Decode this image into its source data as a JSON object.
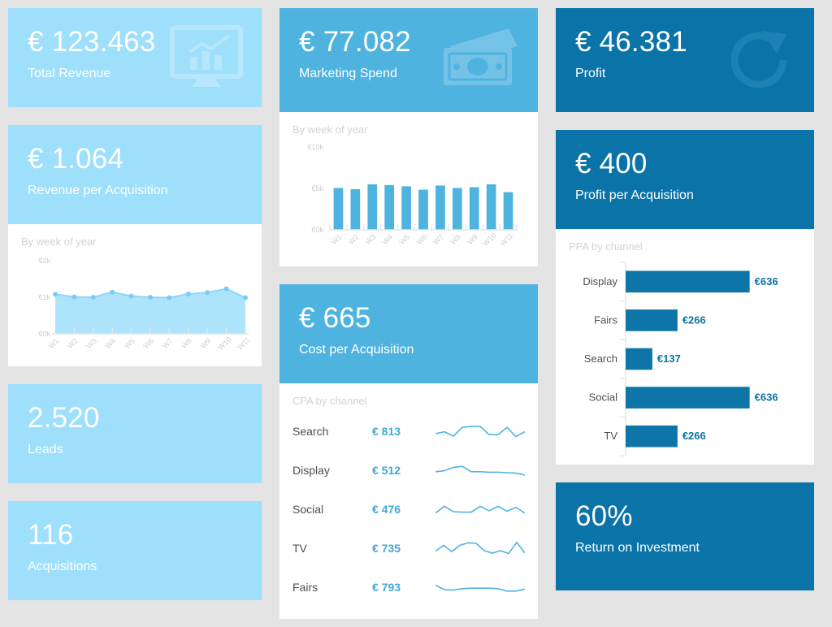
{
  "theme": {
    "light_blue": "#9edffb",
    "mid_blue": "#4fb3e0",
    "dark_blue": "#0a74a8",
    "page_bg": "#e4e4e4",
    "panel_bg": "#ffffff",
    "muted_text": "#cfd2d4"
  },
  "kpis": {
    "total_revenue": {
      "value": "€ 123.463",
      "label": "Total Revenue",
      "icon": "monitor-chart-icon"
    },
    "revenue_per_acq": {
      "value": "€ 1.064",
      "label": "Revenue per Acquisition",
      "icon": "none"
    },
    "leads": {
      "value": "2.520",
      "label": "Leads",
      "icon": "none"
    },
    "acquisitions": {
      "value": "116",
      "label": "Acquisitions",
      "icon": "none"
    },
    "marketing_spend": {
      "value": "€ 77.082",
      "label": "Marketing Spend",
      "icon": "banknotes-icon"
    },
    "cost_per_acq": {
      "value": "€ 665",
      "label": "Cost per Acquisition",
      "icon": "none"
    },
    "profit": {
      "value": "€ 46.381",
      "label": "Profit",
      "icon": "refresh-circle-icon"
    },
    "profit_per_acq": {
      "value": "€ 400",
      "label": "Profit per Acquisition",
      "icon": "none"
    },
    "roi": {
      "value": "60%",
      "label": "Return on Investment",
      "icon": "none"
    }
  },
  "panels": {
    "revenue_per_acq_chart": {
      "title": "By week of year"
    },
    "marketing_spend_chart": {
      "title": "By week of year"
    },
    "cpa_by_channel": {
      "title": "CPA by channel"
    },
    "ppa_by_channel": {
      "title": "PPA by channel"
    }
  },
  "chart_data": [
    {
      "id": "revenue-per-acquisition-area",
      "type": "area",
      "title": "By week of year",
      "xlabel": "",
      "ylabel": "",
      "categories": [
        "W1",
        "W2",
        "W3",
        "W4",
        "W5",
        "W6",
        "W7",
        "W8",
        "W9",
        "W10",
        "W11"
      ],
      "values": [
        1080,
        1010,
        1000,
        1140,
        1030,
        1000,
        990,
        1090,
        1130,
        1230,
        990
      ],
      "ylim": [
        0,
        2000
      ],
      "ytick_labels": [
        "€0k",
        "€1k",
        "€2k"
      ],
      "ytick_values": [
        0,
        1000,
        2000
      ],
      "grid": false,
      "legend": "none",
      "markers": true,
      "line_color": "#9edffb",
      "fill_color": "#aee4fb"
    },
    {
      "id": "marketing-spend-bars",
      "type": "bar",
      "title": "By week of year",
      "xlabel": "",
      "ylabel": "",
      "categories": [
        "W1",
        "W2",
        "W3",
        "W4",
        "W5",
        "W6",
        "W7",
        "W8",
        "W9",
        "W10",
        "W11"
      ],
      "values": [
        5050,
        4900,
        5500,
        5400,
        5250,
        4850,
        5350,
        5050,
        5150,
        5500,
        4550
      ],
      "ylim": [
        0,
        10000
      ],
      "ytick_labels": [
        "€0k",
        "€5k",
        "€10k"
      ],
      "ytick_values": [
        0,
        5000,
        10000
      ],
      "grid": false,
      "legend": "none",
      "bar_color": "#4fb3e0"
    },
    {
      "id": "cpa-by-channel",
      "type": "table",
      "title": "CPA by channel",
      "columns": [
        "channel",
        "value",
        "trend"
      ],
      "rows": [
        {
          "channel": "Search",
          "value": "€ 813",
          "trend": [
            40,
            48,
            30,
            66,
            70,
            70,
            36,
            36,
            66,
            28,
            48
          ]
        },
        {
          "channel": "Display",
          "value": "€ 512",
          "trend": [
            44,
            48,
            62,
            66,
            44,
            44,
            42,
            42,
            40,
            38,
            30
          ]
        },
        {
          "channel": "Social",
          "value": "€ 476",
          "trend": [
            34,
            62,
            40,
            38,
            38,
            62,
            44,
            62,
            42,
            58,
            34
          ]
        },
        {
          "channel": "TV",
          "value": "€ 735",
          "trend": [
            38,
            62,
            36,
            62,
            72,
            70,
            40,
            30,
            40,
            28,
            74,
            30
          ]
        },
        {
          "channel": "Fairs",
          "value": "€ 793",
          "trend": [
            58,
            40,
            38,
            44,
            46,
            46,
            46,
            44,
            34,
            34,
            42
          ]
        }
      ],
      "line_color": "#4fb3e0"
    },
    {
      "id": "ppa-by-channel",
      "type": "bar",
      "orientation": "horizontal",
      "title": "PPA by channel",
      "xlabel": "",
      "ylabel": "",
      "categories": [
        "Display",
        "Fairs",
        "Search",
        "Social",
        "TV"
      ],
      "values": [
        636,
        266,
        137,
        636,
        266
      ],
      "value_labels": [
        "€636",
        "€266",
        "€137",
        "€636",
        "€266"
      ],
      "xlim": [
        0,
        700
      ],
      "grid": false,
      "legend": "none",
      "bar_color": "#0e75a9"
    }
  ]
}
